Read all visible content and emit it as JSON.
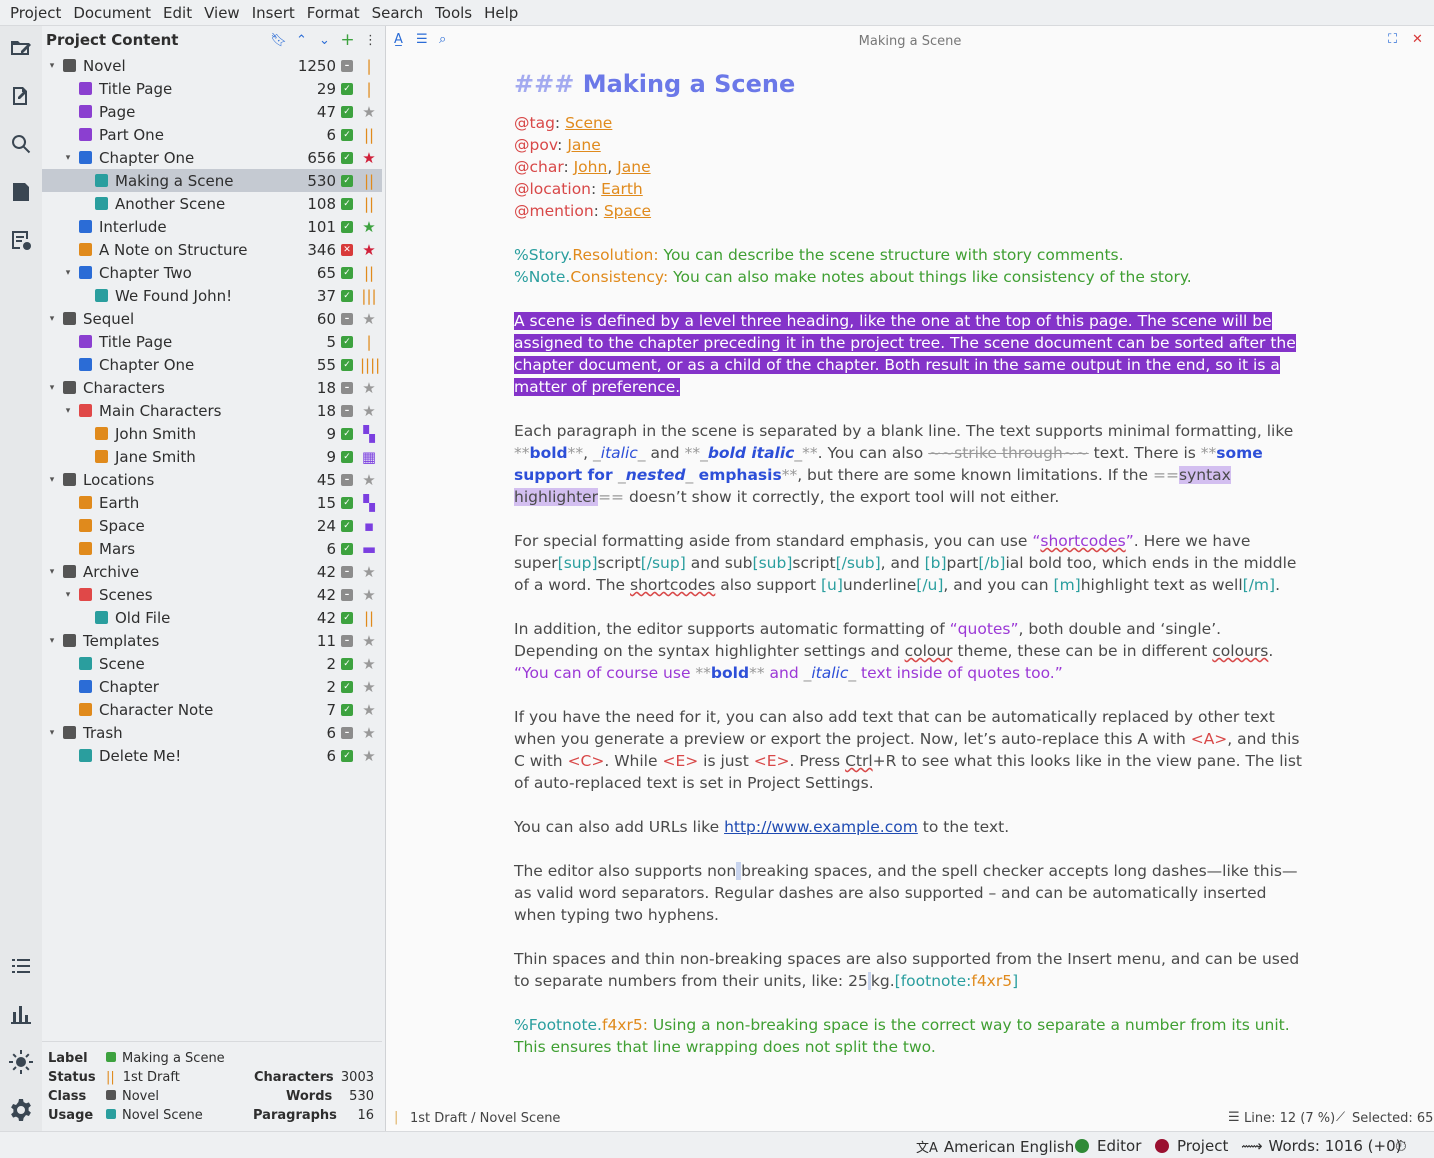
{
  "menu": [
    "Project",
    "Document",
    "Edit",
    "View",
    "Insert",
    "Format",
    "Search",
    "Tools",
    "Help"
  ],
  "tree": {
    "title": "Project Content",
    "items": [
      {
        "name": "Novel",
        "count": "1250",
        "depth": 0,
        "arrow": "▾",
        "icon": "book-icon",
        "icolor": "#555",
        "status": "no",
        "imp": "|",
        "impc": "#e08a1c"
      },
      {
        "name": "Title Page",
        "count": "29",
        "depth": 1,
        "arrow": "",
        "icon": "doc-icon",
        "icolor": "#8b3fd0",
        "status": "ok",
        "imp": "|",
        "impc": "#e08a1c"
      },
      {
        "name": "Page",
        "count": "47",
        "depth": 1,
        "arrow": "",
        "icon": "doc-icon",
        "icolor": "#8b3fd0",
        "status": "ok",
        "imp": "★",
        "impc": "#999"
      },
      {
        "name": "Part One",
        "count": "6",
        "depth": 1,
        "arrow": "",
        "icon": "doc-icon",
        "icolor": "#8b3fd0",
        "status": "ok",
        "imp": "||",
        "impc": "#e08a1c"
      },
      {
        "name": "Chapter One",
        "count": "656",
        "depth": 1,
        "arrow": "▾",
        "icon": "doc-icon",
        "icolor": "#2b6cd6",
        "status": "ok",
        "imp": "★",
        "impc": "#d0203a"
      },
      {
        "name": "Making a Scene",
        "count": "530",
        "depth": 2,
        "arrow": "",
        "icon": "doc-icon",
        "icolor": "#2a9e9e",
        "status": "ok",
        "imp": "||",
        "impc": "#e08a1c",
        "sel": true
      },
      {
        "name": "Another Scene",
        "count": "108",
        "depth": 2,
        "arrow": "",
        "icon": "doc-icon",
        "icolor": "#2a9e9e",
        "status": "ok",
        "imp": "||",
        "impc": "#e08a1c"
      },
      {
        "name": "Interlude",
        "count": "101",
        "depth": 1,
        "arrow": "",
        "icon": "doc-icon",
        "icolor": "#2b6cd6",
        "status": "ok",
        "imp": "★",
        "impc": "#3da23f"
      },
      {
        "name": "A Note on Structure",
        "count": "346",
        "depth": 1,
        "arrow": "",
        "icon": "note-icon",
        "icolor": "#e08a1c",
        "status": "bad",
        "imp": "★",
        "impc": "#d0203a"
      },
      {
        "name": "Chapter Two",
        "count": "65",
        "depth": 1,
        "arrow": "▾",
        "icon": "doc-icon",
        "icolor": "#2b6cd6",
        "status": "ok",
        "imp": "||",
        "impc": "#e08a1c"
      },
      {
        "name": "We Found John!",
        "count": "37",
        "depth": 2,
        "arrow": "",
        "icon": "doc-icon",
        "icolor": "#2a9e9e",
        "status": "ok",
        "imp": "|||",
        "impc": "#e08a1c"
      },
      {
        "name": "Sequel",
        "count": "60",
        "depth": 0,
        "arrow": "▾",
        "icon": "book-icon",
        "icolor": "#555",
        "status": "no",
        "imp": "★",
        "impc": "#999"
      },
      {
        "name": "Title Page",
        "count": "5",
        "depth": 1,
        "arrow": "",
        "icon": "doc-icon",
        "icolor": "#8b3fd0",
        "status": "ok",
        "imp": "|",
        "impc": "#e08a1c"
      },
      {
        "name": "Chapter One",
        "count": "55",
        "depth": 1,
        "arrow": "",
        "icon": "doc-icon",
        "icolor": "#2b6cd6",
        "status": "ok",
        "imp": "||||",
        "impc": "#e08a1c"
      },
      {
        "name": "Characters",
        "count": "18",
        "depth": 0,
        "arrow": "▾",
        "icon": "people-icon",
        "icolor": "#555",
        "status": "no",
        "imp": "★",
        "impc": "#999"
      },
      {
        "name": "Main Characters",
        "count": "18",
        "depth": 1,
        "arrow": "▾",
        "icon": "folder-icon",
        "icolor": "#e04848",
        "status": "no",
        "imp": "★",
        "impc": "#999"
      },
      {
        "name": "John Smith",
        "count": "9",
        "depth": 2,
        "arrow": "",
        "icon": "note-icon",
        "icolor": "#e08a1c",
        "status": "ok",
        "imp": "▚",
        "impc": "#7b3fe0"
      },
      {
        "name": "Jane Smith",
        "count": "9",
        "depth": 2,
        "arrow": "",
        "icon": "note-icon",
        "icolor": "#e08a1c",
        "status": "ok",
        "imp": "▦",
        "impc": "#7b3fe0"
      },
      {
        "name": "Locations",
        "count": "45",
        "depth": 0,
        "arrow": "▾",
        "icon": "globe-icon",
        "icolor": "#555",
        "status": "no",
        "imp": "★",
        "impc": "#999"
      },
      {
        "name": "Earth",
        "count": "15",
        "depth": 1,
        "arrow": "",
        "icon": "note-icon",
        "icolor": "#e08a1c",
        "status": "ok",
        "imp": "▚",
        "impc": "#7b3fe0"
      },
      {
        "name": "Space",
        "count": "24",
        "depth": 1,
        "arrow": "",
        "icon": "note-icon",
        "icolor": "#e08a1c",
        "status": "ok",
        "imp": "▪",
        "impc": "#7b3fe0"
      },
      {
        "name": "Mars",
        "count": "6",
        "depth": 1,
        "arrow": "",
        "icon": "note-icon",
        "icolor": "#e08a1c",
        "status": "ok",
        "imp": "▬",
        "impc": "#7b3fe0"
      },
      {
        "name": "Archive",
        "count": "42",
        "depth": 0,
        "arrow": "▾",
        "icon": "archive-icon",
        "icolor": "#555",
        "status": "no",
        "imp": "★",
        "impc": "#999"
      },
      {
        "name": "Scenes",
        "count": "42",
        "depth": 1,
        "arrow": "▾",
        "icon": "folder-icon",
        "icolor": "#e04848",
        "status": "no",
        "imp": "★",
        "impc": "#999"
      },
      {
        "name": "Old File",
        "count": "42",
        "depth": 2,
        "arrow": "",
        "icon": "doc-icon",
        "icolor": "#2a9e9e",
        "status": "ok",
        "imp": "||",
        "impc": "#e08a1c"
      },
      {
        "name": "Templates",
        "count": "11",
        "depth": 0,
        "arrow": "▾",
        "icon": "template-icon",
        "icolor": "#555",
        "status": "no",
        "imp": "★",
        "impc": "#999"
      },
      {
        "name": "Scene",
        "count": "2",
        "depth": 1,
        "arrow": "",
        "icon": "doc-icon",
        "icolor": "#2a9e9e",
        "status": "ok",
        "imp": "★",
        "impc": "#999"
      },
      {
        "name": "Chapter",
        "count": "2",
        "depth": 1,
        "arrow": "",
        "icon": "doc-icon",
        "icolor": "#2b6cd6",
        "status": "ok",
        "imp": "★",
        "impc": "#999"
      },
      {
        "name": "Character Note",
        "count": "7",
        "depth": 1,
        "arrow": "",
        "icon": "note-icon",
        "icolor": "#e08a1c",
        "status": "ok",
        "imp": "★",
        "impc": "#999"
      },
      {
        "name": "Trash",
        "count": "6",
        "depth": 0,
        "arrow": "▾",
        "icon": "trash-icon",
        "icolor": "#555",
        "status": "no",
        "imp": "★",
        "impc": "#999"
      },
      {
        "name": "Delete Me!",
        "count": "6",
        "depth": 1,
        "arrow": "",
        "icon": "doc-icon",
        "icolor": "#2a9e9e",
        "status": "ok",
        "imp": "★",
        "impc": "#999"
      }
    ]
  },
  "details": {
    "label_k": "Label",
    "label_v": "Making a Scene",
    "status_k": "Status",
    "status_v": "1st Draft",
    "class_k": "Class",
    "class_v": "Novel",
    "usage_k": "Usage",
    "usage_v": "Novel Scene",
    "chars_k": "Characters",
    "chars_v": "3003",
    "words_k": "Words",
    "words_v": "530",
    "paras_k": "Paragraphs",
    "paras_v": "16"
  },
  "editor": {
    "title": "Making a Scene",
    "heading_marker": "###",
    "heading": "Making a Scene",
    "footer_left": "1st Draft / Novel Scene",
    "footer_line": "Line: 12 (7 %)",
    "footer_sel": "Selected: 65"
  },
  "statusbar": {
    "language": "American English",
    "editor": "Editor",
    "project": "Project",
    "words": "Words: 1016 (+0)"
  },
  "colors": {
    "accent": "#2b6cd6",
    "selection": "#8433c9",
    "editor_dot": "#2f8a36",
    "project_dot": "#9a1030"
  }
}
